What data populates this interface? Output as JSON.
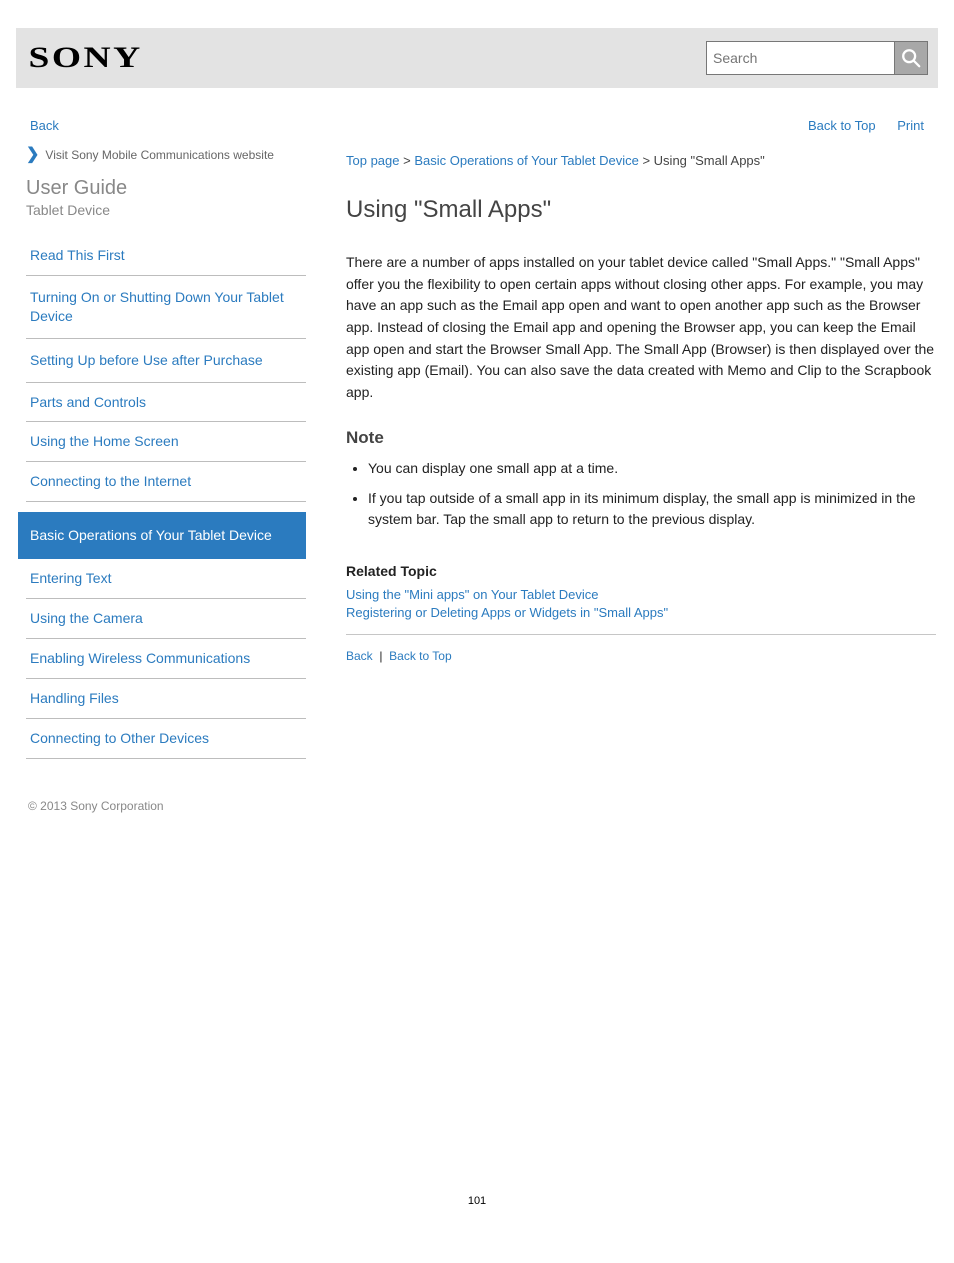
{
  "header": {
    "logo": "SONY",
    "search_placeholder": "Search"
  },
  "top_links": {
    "back": "Back",
    "back_to_top": "Back to Top",
    "print": "Print"
  },
  "sidebar": {
    "notice": "Visit Sony Mobile Communications website",
    "guide_title": "User Guide",
    "model": "Tablet Device",
    "items": [
      "Read This First",
      "Turning On or Shutting Down Your Tablet Device",
      "Setting Up before Use after Purchase",
      "Parts and Controls",
      "Using the Home Screen",
      "Connecting to the Internet"
    ],
    "selected": "Basic Operations of Your Tablet Device",
    "items_after": [
      "Entering Text",
      "Using the Camera",
      "Enabling Wireless Communications",
      "Handling Files",
      "Connecting to Other Devices"
    ],
    "foot_note": "© 2013 Sony Corporation"
  },
  "breadcrumb": {
    "top": "Top page",
    "sep": " > ",
    "cat": "Basic Operations of Your Tablet Device",
    "curr": "Using \"Small Apps\""
  },
  "article": {
    "h1": "Using \"Small Apps\"",
    "p1": "There are a number of apps installed on your tablet device called \"Small Apps.\" \"Small Apps\" offer you the flexibility to open certain apps without closing other apps. For example, you may have an app such as the Email app open and want to open another app such as the Browser app. Instead of closing the Email app and opening the Browser app, you can keep the Email app open and start the Browser Small App. The Small App (Browser) is then displayed over the existing app (Email). You can also save the data created with Memo and Clip to the Scrapbook app.",
    "h2": "Note",
    "bullets": [
      "You can display one small app at a time.",
      "If you tap outside of a small app in its minimum display, the small app is minimized in the system bar. Tap the small app to return to the previous display."
    ],
    "related_h": "Related Topic",
    "related": [
      "Using the \"Mini apps\" on Your Tablet Device",
      "Registering or Deleting Apps or Widgets in \"Small Apps\""
    ]
  },
  "footer": {
    "back": "Back",
    "back_to_top": "Back to Top"
  },
  "page_number": "101"
}
